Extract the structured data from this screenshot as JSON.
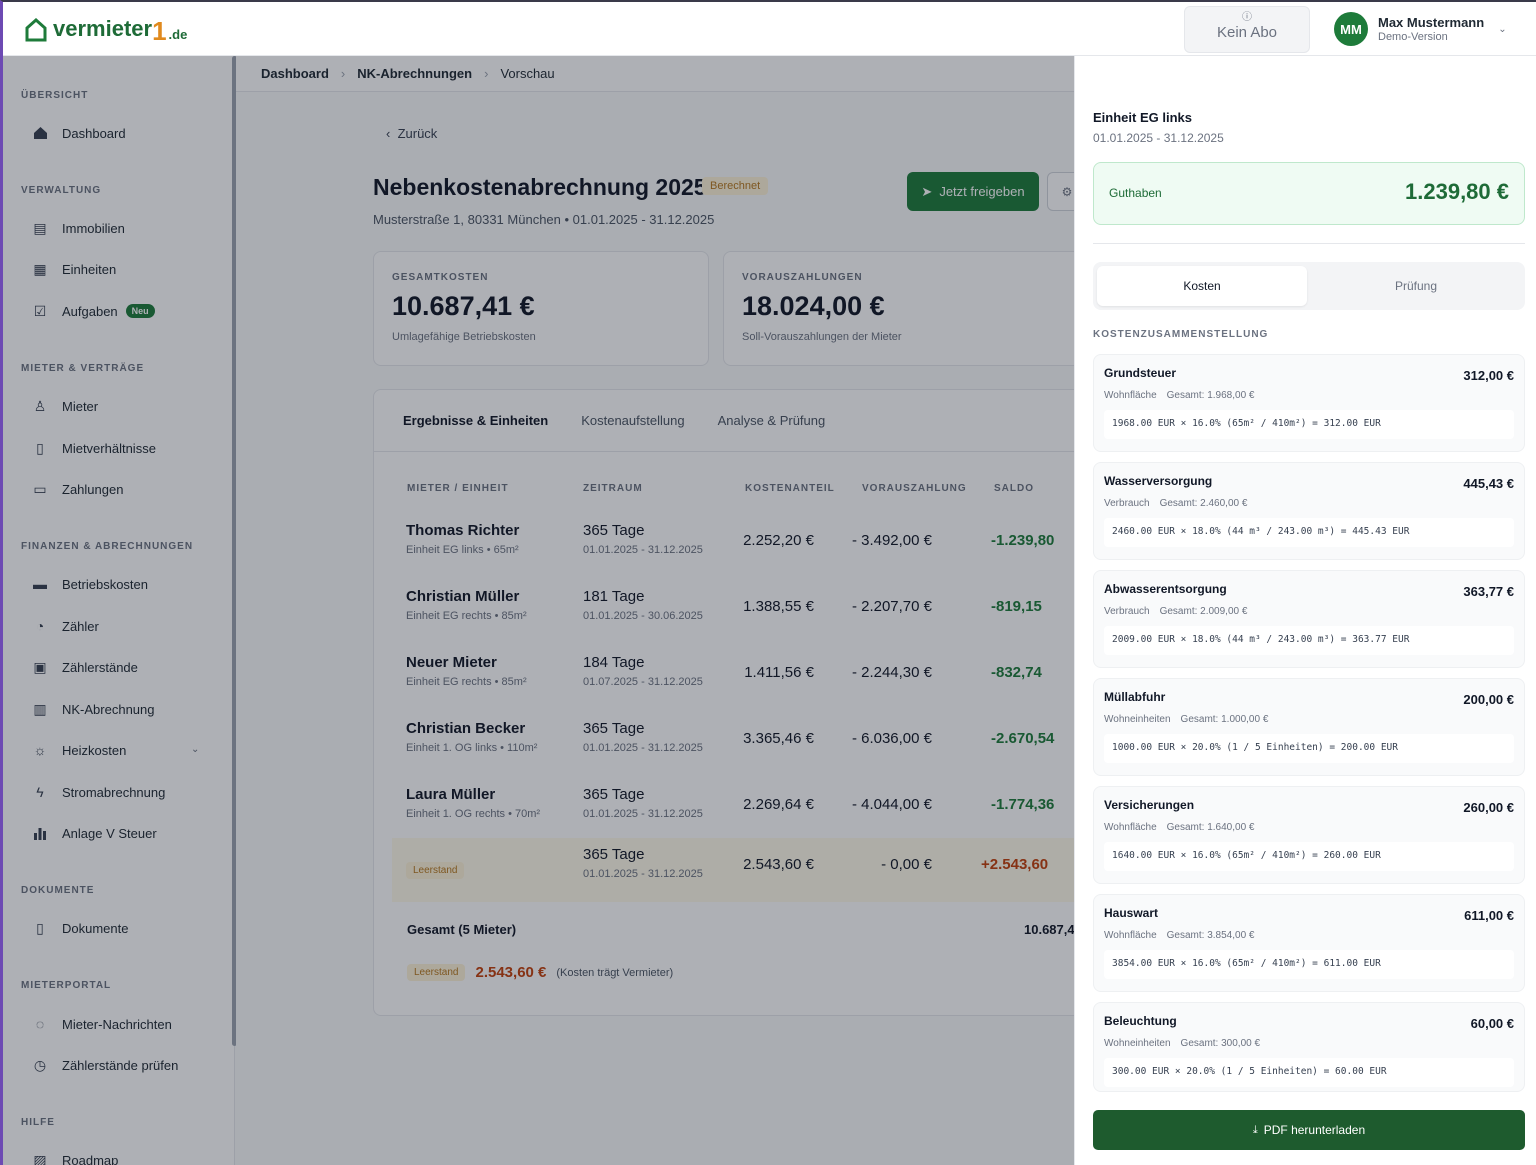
{
  "header": {
    "logo_text": "vermieter",
    "logo_num": "1",
    "logo_tld": ".de",
    "abo_label": "Kein Abo",
    "user_initials": "MM",
    "user_name": "Max Mustermann",
    "user_sub": "Demo-Version"
  },
  "sidebar": {
    "sections": {
      "uebersicht": "ÜBERSICHT",
      "verwaltung": "VERWALTUNG",
      "mieter": "MIETER & VERTRÄGE",
      "finanzen": "FINANZEN & ABRECHNUNGEN",
      "dokumente": "DOKUMENTE",
      "portal": "MIETERPORTAL",
      "hilfe": "HILFE"
    },
    "items": {
      "dashboard": "Dashboard",
      "immobilien": "Immobilien",
      "einheiten": "Einheiten",
      "aufgaben": "Aufgaben",
      "aufgaben_badge": "Neu",
      "mieter": "Mieter",
      "mietverhaeltnisse": "Mietverhältnisse",
      "zahlungen": "Zahlungen",
      "betriebskosten": "Betriebskosten",
      "zaehler": "Zähler",
      "zaehlerstaende": "Zählerstände",
      "nk_abrechnung": "NK-Abrechnung",
      "heizkosten": "Heizkosten",
      "stromabrechnung": "Stromabrechnung",
      "anlage_v": "Anlage V Steuer",
      "dokumente": "Dokumente",
      "nachrichten": "Mieter-Nachrichten",
      "zaehler_pruefen": "Zählerstände prüfen",
      "roadmap": "Roadmap"
    }
  },
  "breadcrumb": [
    "Dashboard",
    "NK-Abrechnungen",
    "Vorschau"
  ],
  "main": {
    "back": "Zurück",
    "title": "Nebenkostenabrechnung 2025",
    "status": "Berechnet",
    "subtitle": "Musterstraße 1, 80331 München • 01.01.2025 - 31.12.2025",
    "release_btn": "Jetzt freigeben",
    "cards": [
      {
        "label": "GESAMTKOSTEN",
        "value": "10.687,41 €",
        "sub": "Umlagefähige Betriebskosten"
      },
      {
        "label": "VORAUSZAHLUNGEN",
        "value": "18.024,00 €",
        "sub": "Soll-Vorauszahlungen der Mieter"
      }
    ],
    "tabs": [
      "Ergebnisse & Einheiten",
      "Kostenaufstellung",
      "Analyse & Prüfung"
    ],
    "columns": [
      "MIETER / EINHEIT",
      "ZEITRAUM",
      "KOSTENANTEIL",
      "VORAUSZAHLUNG",
      "SALDO"
    ],
    "rows": [
      {
        "name": "Thomas Richter",
        "unit": "Einheit EG links • 65m²",
        "days": "365 Tage",
        "period": "01.01.2025 - 31.12.2025",
        "cost": "2.252,20 €",
        "pay": "- 3.492,00 €",
        "saldo": "-1.239,80"
      },
      {
        "name": "Christian Müller",
        "unit": "Einheit EG rechts • 85m²",
        "days": "181 Tage",
        "period": "01.01.2025 - 30.06.2025",
        "cost": "1.388,55 €",
        "pay": "- 2.207,70 €",
        "saldo": "-819,15"
      },
      {
        "name": "Neuer Mieter",
        "unit": "Einheit EG rechts • 85m²",
        "days": "184 Tage",
        "period": "01.07.2025 - 31.12.2025",
        "cost": "1.411,56 €",
        "pay": "- 2.244,30 €",
        "saldo": "-832,74"
      },
      {
        "name": "Christian Becker",
        "unit": "Einheit 1. OG links • 110m²",
        "days": "365 Tage",
        "period": "01.01.2025 - 31.12.2025",
        "cost": "3.365,46 €",
        "pay": "- 6.036,00 €",
        "saldo": "-2.670,54"
      },
      {
        "name": "Laura Müller",
        "unit": "Einheit 1. OG rechts • 70m²",
        "days": "365 Tage",
        "period": "01.01.2025 - 31.12.2025",
        "cost": "2.269,64 €",
        "pay": "- 4.044,00 €",
        "saldo": "-1.774,36"
      }
    ],
    "vacancy_row": {
      "label": "Leerstand",
      "days": "365 Tage",
      "period": "01.01.2025 - 31.12.2025",
      "cost": "2.543,60 €",
      "pay": "- 0,00 €",
      "saldo": "+2.543,60"
    },
    "total_label": "Gesamt (5 Mieter)",
    "total_value": "10.687,4",
    "vacancy_summary": {
      "label": "Leerstand",
      "amount": "2.543,60 €",
      "note": "(Kosten trägt Vermieter)"
    }
  },
  "drawer": {
    "title": "Einheit EG links",
    "period": "01.01.2025 - 31.12.2025",
    "guthaben_label": "Guthaben",
    "guthaben_value": "1.239,80 €",
    "tab_kosten": "Kosten",
    "tab_pruefung": "Prüfung",
    "section": "KOSTENZUSAMMENSTELLUNG",
    "items": [
      {
        "name": "Grundsteuer",
        "value": "312,00 €",
        "key": "Wohnfläche",
        "total": "Gesamt: 1.968,00 €",
        "formula": "1968.00 EUR × 16.0% (65m² / 410m²) = 312.00 EUR"
      },
      {
        "name": "Wasserversorgung",
        "value": "445,43 €",
        "key": "Verbrauch",
        "total": "Gesamt: 2.460,00 €",
        "formula": "2460.00 EUR × 18.0% (44 m³ / 243.00 m³) = 445.43 EUR"
      },
      {
        "name": "Abwasserentsorgung",
        "value": "363,77 €",
        "key": "Verbrauch",
        "total": "Gesamt: 2.009,00 €",
        "formula": "2009.00 EUR × 18.0% (44 m³ / 243.00 m³) = 363.77 EUR"
      },
      {
        "name": "Müllabfuhr",
        "value": "200,00 €",
        "key": "Wohneinheiten",
        "total": "Gesamt: 1.000,00 €",
        "formula": "1000.00 EUR × 20.0% (1 / 5 Einheiten) = 200.00 EUR"
      },
      {
        "name": "Versicherungen",
        "value": "260,00 €",
        "key": "Wohnfläche",
        "total": "Gesamt: 1.640,00 €",
        "formula": "1640.00 EUR × 16.0% (65m² / 410m²) = 260.00 EUR"
      },
      {
        "name": "Hauswart",
        "value": "611,00 €",
        "key": "Wohnfläche",
        "total": "Gesamt: 3.854,00 €",
        "formula": "3854.00 EUR × 16.0% (65m² / 410m²) = 611.00 EUR"
      },
      {
        "name": "Beleuchtung",
        "value": "60,00 €",
        "key": "Wohneinheiten",
        "total": "Gesamt: 300,00 €",
        "formula": "300.00 EUR × 20.0% (1 / 5 Einheiten) = 60.00 EUR"
      }
    ],
    "pdf_btn": "PDF herunterladen"
  }
}
